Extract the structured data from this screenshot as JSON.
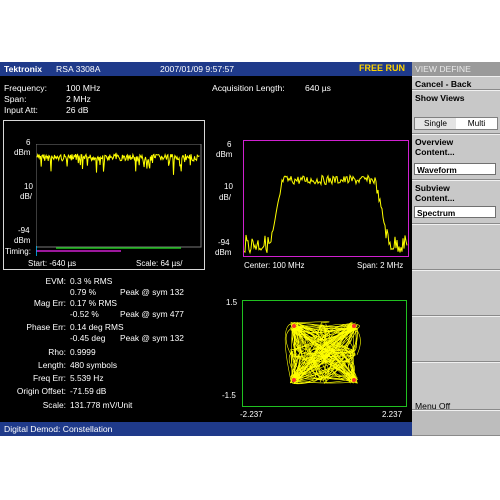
{
  "header": {
    "brand": "Tektronix",
    "model": "RSA 3308A",
    "datetime": "2007/01/09 9:57:57",
    "run_state": "FREE RUN"
  },
  "settings": {
    "frequency_label": "Frequency:",
    "frequency_value": "100 MHz",
    "span_label": "Span:",
    "span_value": "2 MHz",
    "input_att_label": "Input Att:",
    "input_att_value": "26 dB",
    "acq_label": "Acquisition Length:",
    "acq_value": "640 µs"
  },
  "waveform_plot": {
    "top": "6",
    "unit1": "dBm",
    "div": "10",
    "unit2": "dB/",
    "bottom": "-94",
    "unit3": "dBm",
    "timing_label": "Timing:",
    "start": "Start: -640 µs",
    "scale": "Scale: 64 µs/"
  },
  "spectrum_plot": {
    "top": "6",
    "unit1": "dBm",
    "div": "10",
    "unit2": "dB/",
    "bottom": "-94",
    "unit3": "dBm",
    "center": "Center: 100 MHz",
    "span": "Span: 2 MHz"
  },
  "constellation_plot": {
    "y_top": "1.5",
    "y_bottom": "-1.5",
    "x_left": "-2.237",
    "x_right": "2.237"
  },
  "measurements": {
    "evm_label": "EVM:",
    "evm_rms": "0.3   % RMS",
    "evm_peak": "0.79 %",
    "evm_peak_at": "Peak @ sym 132",
    "mag_label": "Mag Err:",
    "mag_rms": "0.17 % RMS",
    "mag_peak": "-0.52 %",
    "mag_peak_at": "Peak @ sym 477",
    "phase_label": "Phase Err:",
    "phase_rms": "0.14 deg RMS",
    "phase_peak": "-0.45 deg",
    "phase_peak_at": "Peak @ sym 132",
    "rho_label": "Rho:",
    "rho_value": "0.9999",
    "length_label": "Length:",
    "length_value": "480 symbols",
    "freq_err_label": "Freq Err:",
    "freq_err_value": "5.539 Hz",
    "origin_label": "Origin Offset:",
    "origin_value": "-71.59 dB",
    "scale_label": "Scale:",
    "scale_value": "131.778 mV/Unit"
  },
  "status": {
    "text": "Digital Demod: Constellation"
  },
  "menu": {
    "title": "VIEW DEFINE",
    "cancel": "Cancel - Back",
    "show_views": "Show Views",
    "single": "Single",
    "multi": "Multi",
    "overview_label": "Overview Content...",
    "overview_line1": "Overview",
    "overview_line2": "Content...",
    "overview_value": "Waveform",
    "subview_line1": "Subview",
    "subview_line2": "Content...",
    "subview_value": "Spectrum",
    "menu_off": "Menu Off"
  },
  "colors": {
    "trace": "#ffff00",
    "titlebar": "#1f3a8a",
    "spectrum_frame": "#d020d0",
    "constellation_frame": "#20c020",
    "run_state": "#ffd400"
  }
}
